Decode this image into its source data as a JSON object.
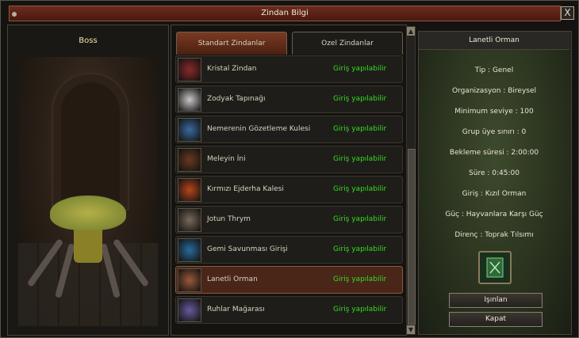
{
  "window": {
    "title": "Zindan Bilgi",
    "close_glyph": "X"
  },
  "boss_panel": {
    "label": "Boss"
  },
  "tabs": [
    {
      "label": "Standart Zindanlar",
      "active": true
    },
    {
      "label": "Ozel Zindanlar",
      "active": false
    }
  ],
  "dungeons": [
    {
      "name": "Kristal Zindan",
      "status": "Giriş yapılabilir",
      "icon": "crystal-demon-icon",
      "color": "#8a2a2a"
    },
    {
      "name": "Zodyak Tapınağı",
      "status": "Giriş yapılabilir",
      "icon": "zodiac-tiger-icon",
      "color": "#c8c8c8"
    },
    {
      "name": "Nemerenin Gözetleme Kulesi",
      "status": "Giriş yapılabilir",
      "icon": "ice-dragon-icon",
      "color": "#3a6a9a"
    },
    {
      "name": "Meleyin İni",
      "status": "Giriş yapılabilir",
      "icon": "meley-dragon-icon",
      "color": "#6a3a1e"
    },
    {
      "name": "Kırmızı Ejderha Kalesi",
      "status": "Giriş yapılabilir",
      "icon": "red-dragon-icon",
      "color": "#b8461a"
    },
    {
      "name": "Jotun Thrym",
      "status": "Giriş yapılabilir",
      "icon": "jotun-giant-icon",
      "color": "#7a6a5a"
    },
    {
      "name": "Gemi Savunması Girişi",
      "status": "Giriş yapılabilir",
      "icon": "sea-creature-icon",
      "color": "#2a6a9a"
    },
    {
      "name": "Lanetli Orman",
      "status": "Giriş yapılabilir",
      "icon": "cursed-forest-icon",
      "color": "#9a5a3a",
      "selected": true
    },
    {
      "name": "Ruhlar Mağarası",
      "status": "Giriş yapılabilir",
      "icon": "spirit-cave-icon",
      "color": "#6a5a9a"
    }
  ],
  "scroll": {
    "up_glyph": "▲",
    "down_glyph": "▼"
  },
  "info": {
    "title": "Lanetli Orman",
    "lines": [
      "Tip : Genel",
      "Organizasyon : Bireysel",
      "Minimum seviye : 100",
      "Grup üye sınırı : 0",
      "Bekleme süresi : 2:00:00",
      "Süre : 0:45:00",
      "Giriş : Kızıl Orman",
      "Güç : Hayvanlara Karşı Güç",
      "Direnç : Toprak Tılsımı"
    ],
    "item_icon": "green-book-icon",
    "teleport_label": "Işınlan",
    "close_label": "Kapat"
  }
}
